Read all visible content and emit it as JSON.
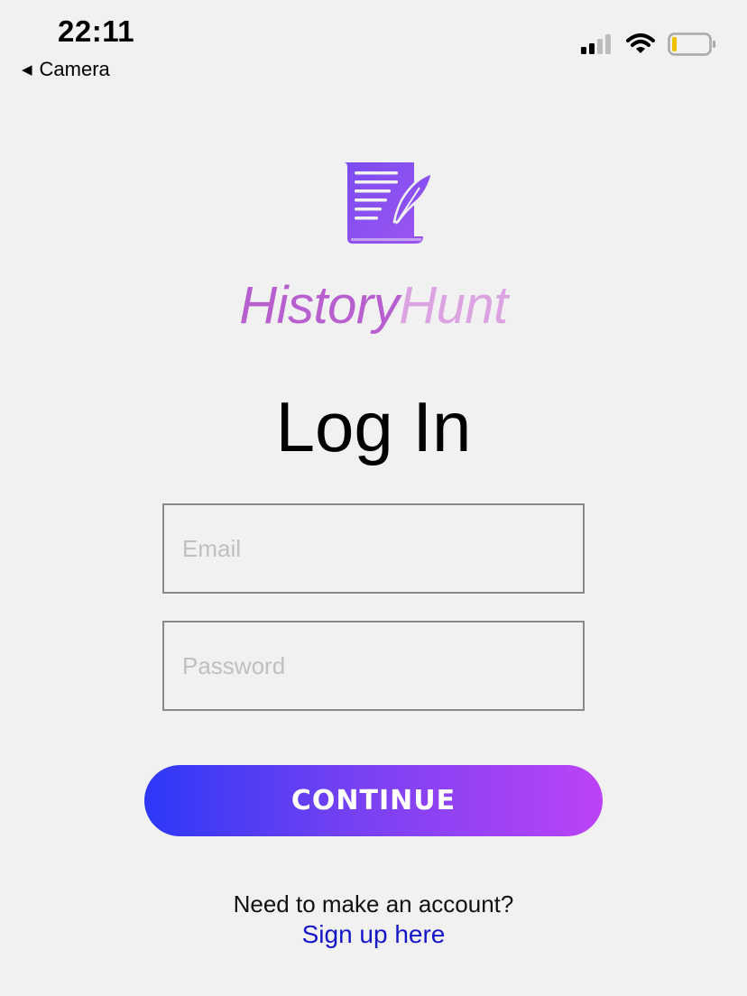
{
  "status_bar": {
    "time": "22:11",
    "back_label": "Camera",
    "icons": [
      "signal-icon",
      "wifi-icon",
      "battery-icon"
    ]
  },
  "brand": {
    "logo_icon": "scroll-quill-icon",
    "name_part_1": "History",
    "name_part_2": "Hunt",
    "colors": {
      "primary": "#b85fcf",
      "secondary": "#dca3e2",
      "logo": "#8a4ff2"
    }
  },
  "page": {
    "title": "Log In"
  },
  "form": {
    "email": {
      "value": "",
      "placeholder": "Email"
    },
    "password": {
      "value": "",
      "placeholder": "Password"
    },
    "submit_label": "CONTINUE",
    "submit_gradient": [
      "#2d38f7",
      "#bc43f7"
    ]
  },
  "footer": {
    "prompt": "Need to make an account?",
    "link_label": "Sign up here",
    "link_color": "#1616c9"
  }
}
